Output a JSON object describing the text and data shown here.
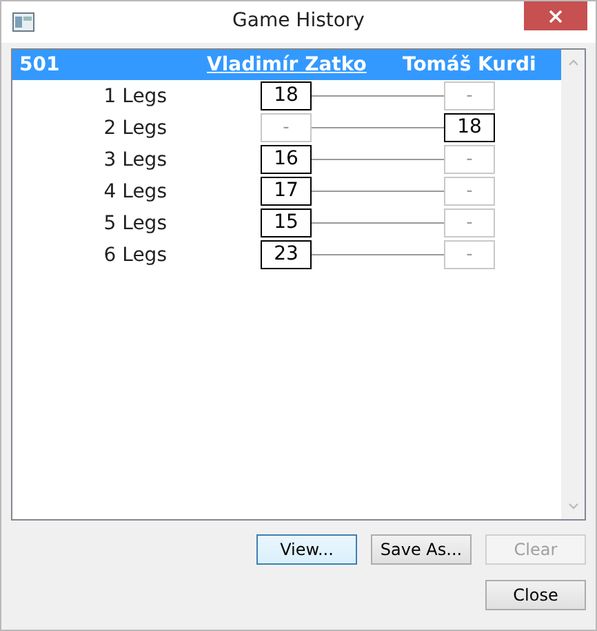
{
  "window": {
    "title": "Game History"
  },
  "header": {
    "game": "501",
    "players": [
      {
        "name": "Vladimír Zatko",
        "selected": true
      },
      {
        "name": "Tomáš Kurdi",
        "selected": false
      }
    ]
  },
  "legs": [
    {
      "label": "1 Legs",
      "scores": [
        {
          "value": "18",
          "won": true
        },
        {
          "value": "-",
          "won": false
        }
      ]
    },
    {
      "label": "2 Legs",
      "scores": [
        {
          "value": "-",
          "won": false
        },
        {
          "value": "18",
          "won": true
        }
      ]
    },
    {
      "label": "3 Legs",
      "scores": [
        {
          "value": "16",
          "won": true
        },
        {
          "value": "-",
          "won": false
        }
      ]
    },
    {
      "label": "4 Legs",
      "scores": [
        {
          "value": "17",
          "won": true
        },
        {
          "value": "-",
          "won": false
        }
      ]
    },
    {
      "label": "5 Legs",
      "scores": [
        {
          "value": "15",
          "won": true
        },
        {
          "value": "-",
          "won": false
        }
      ]
    },
    {
      "label": "6 Legs",
      "scores": [
        {
          "value": "23",
          "won": true
        },
        {
          "value": "-",
          "won": false
        }
      ]
    }
  ],
  "buttons": [
    {
      "label": "View...",
      "disabled": false,
      "default": true
    },
    {
      "label": "Save As...",
      "disabled": false,
      "default": false
    },
    {
      "label": "Clear",
      "disabled": true,
      "default": false
    },
    {
      "label": "Close",
      "disabled": false,
      "default": false
    }
  ]
}
